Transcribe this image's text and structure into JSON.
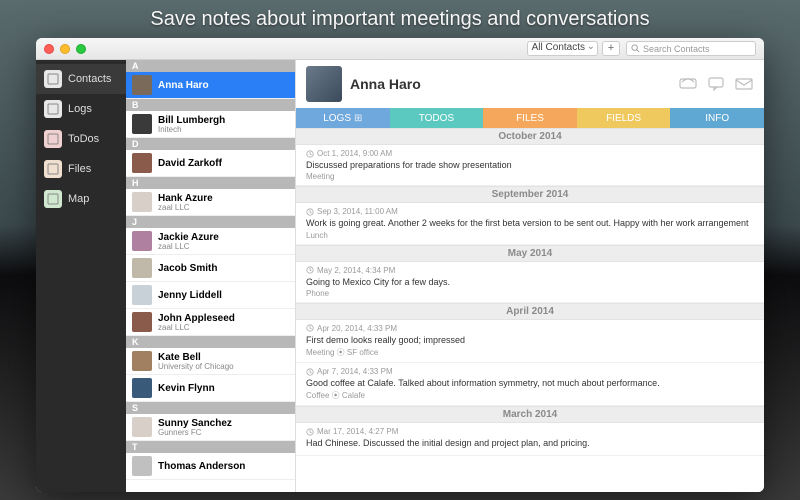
{
  "banner": "Save notes about important meetings and conversations",
  "toolbar": {
    "filter": "All Contacts",
    "search_placeholder": "Search Contacts"
  },
  "sidebar": {
    "items": [
      {
        "label": "Contacts",
        "icon": "contacts-icon",
        "color": "#e8e8e8"
      },
      {
        "label": "Logs",
        "icon": "logs-icon",
        "color": "#e8e8e8"
      },
      {
        "label": "ToDos",
        "icon": "todos-icon",
        "color": "#f0d0d0"
      },
      {
        "label": "Files",
        "icon": "files-icon",
        "color": "#f0e0d0"
      },
      {
        "label": "Map",
        "icon": "map-icon",
        "color": "#d0e8d0"
      }
    ],
    "active_index": 0
  },
  "contacts": {
    "sections": [
      {
        "letter": "A",
        "rows": [
          {
            "name": "Anna Haro",
            "sub": "",
            "selected": true,
            "avcolor": "#7a6a5a"
          }
        ]
      },
      {
        "letter": "B",
        "rows": [
          {
            "name": "Bill Lumbergh",
            "sub": "Initech",
            "avcolor": "#3a3a3a"
          }
        ]
      },
      {
        "letter": "D",
        "rows": [
          {
            "name": "David Zarkoff",
            "sub": "",
            "avcolor": "#8a5a4a"
          }
        ]
      },
      {
        "letter": "H",
        "rows": [
          {
            "name": "Hank Azure",
            "sub": "zaal LLC",
            "avcolor": "#d8d0c8"
          }
        ]
      },
      {
        "letter": "J",
        "rows": [
          {
            "name": "Jackie Azure",
            "sub": "zaal LLC",
            "avcolor": "#b080a0"
          },
          {
            "name": "Jacob Smith",
            "sub": "",
            "avcolor": "#c0b8a8"
          },
          {
            "name": "Jenny Liddell",
            "sub": "",
            "avcolor": "#c8d0d8"
          },
          {
            "name": "John Appleseed",
            "sub": "zaal LLC",
            "avcolor": "#8a5a4a"
          }
        ]
      },
      {
        "letter": "K",
        "rows": [
          {
            "name": "Kate Bell",
            "sub": "University of Chicago",
            "avcolor": "#a08060"
          },
          {
            "name": "Kevin Flynn",
            "sub": "",
            "avcolor": "#3a5a7a"
          }
        ]
      },
      {
        "letter": "S",
        "rows": [
          {
            "name": "Sunny Sanchez",
            "sub": "Gunners FC",
            "avcolor": "#d8d0c8"
          }
        ]
      },
      {
        "letter": "T",
        "rows": [
          {
            "name": "Thomas Anderson",
            "sub": "",
            "avcolor": "#c0c0c0"
          }
        ]
      }
    ]
  },
  "detail": {
    "name": "Anna Haro",
    "tabs": {
      "logs": "LOGS",
      "todos": "TODOS",
      "files": "FILES",
      "fields": "FIELDS",
      "info": "INFO"
    },
    "log_months": [
      {
        "label": "October 2014",
        "entries": [
          {
            "time": "Oct 1, 2014, 9:00 AM",
            "text": "Discussed preparations for trade show presentation",
            "tags": "Meeting"
          }
        ]
      },
      {
        "label": "September 2014",
        "entries": [
          {
            "time": "Sep 3, 2014, 11:00 AM",
            "text": "Work is going great. Another 2 weeks for the first beta version to be sent out. Happy with her work arrangement",
            "tags": "Lunch"
          }
        ]
      },
      {
        "label": "May 2014",
        "entries": [
          {
            "time": "May 2, 2014, 4:34 PM",
            "text": "Going to Mexico City for a few days.",
            "tags": "Phone"
          }
        ]
      },
      {
        "label": "April 2014",
        "entries": [
          {
            "time": "Apr 20, 2014, 4:33 PM",
            "text": "First demo looks really good; impressed",
            "tags": "Meeting   ⦿ SF office"
          },
          {
            "time": "Apr 7, 2014, 4:33 PM",
            "text": "Good coffee at Calafe. Talked about information symmetry, not much about performance.",
            "tags": "Coffee   ⦿ Calafe"
          }
        ]
      },
      {
        "label": "March 2014",
        "entries": [
          {
            "time": "Mar 17, 2014, 4:27 PM",
            "text": "Had Chinese. Discussed the initial design and project plan, and pricing.",
            "tags": ""
          }
        ]
      }
    ]
  }
}
